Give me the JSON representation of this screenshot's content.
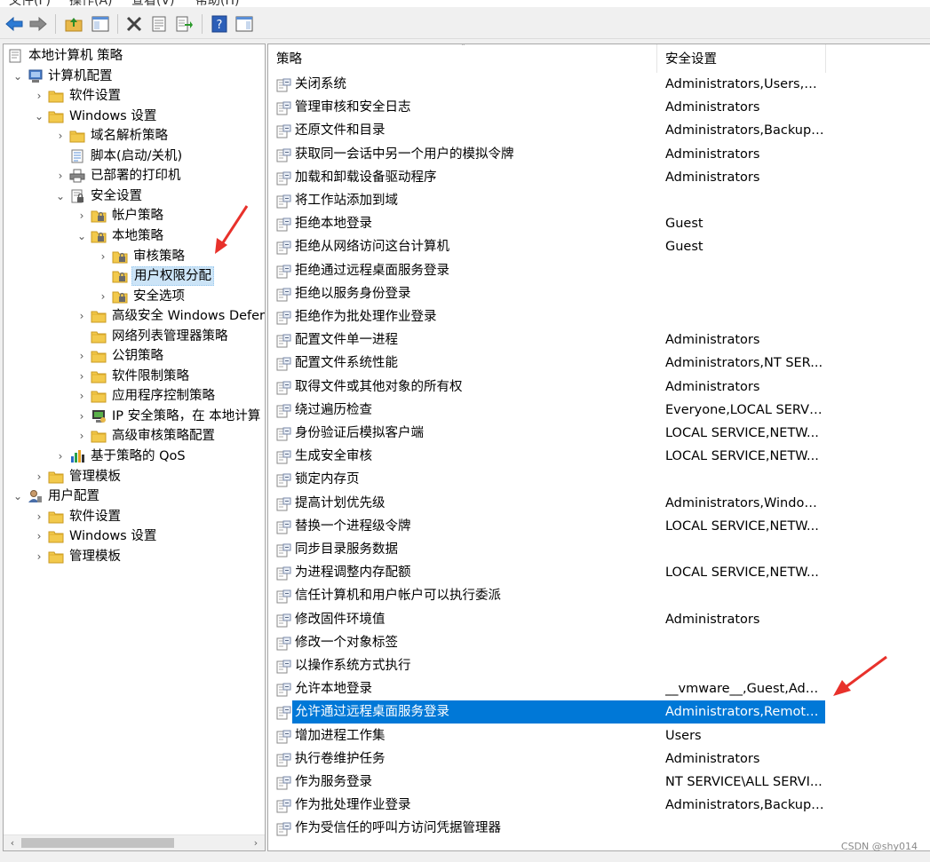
{
  "menu": [
    "文件(F)",
    "操作(A)",
    "查看(V)",
    "帮助(H)"
  ],
  "toolbar_icons": [
    "back-arrow-icon",
    "forward-arrow-icon",
    "up-folder-icon",
    "show-hide-tree-icon",
    "delete-icon",
    "properties-icon",
    "export-list-icon",
    "help-icon",
    "action-pane-icon"
  ],
  "tree": [
    {
      "label": "本地计算机 策略",
      "depth": 0,
      "arrow": "",
      "icon": "policy-doc-icon"
    },
    {
      "label": "计算机配置",
      "depth": 1,
      "arrow": "v",
      "icon": "computer-icon"
    },
    {
      "label": "软件设置",
      "depth": 2,
      "arrow": ">",
      "icon": "folder-icon"
    },
    {
      "label": "Windows 设置",
      "depth": 2,
      "arrow": "v",
      "icon": "folder-icon"
    },
    {
      "label": "域名解析策略",
      "depth": 3,
      "arrow": ">",
      "icon": "folder-icon"
    },
    {
      "label": "脚本(启动/关机)",
      "depth": 3,
      "arrow": "",
      "icon": "script-icon"
    },
    {
      "label": "已部署的打印机",
      "depth": 3,
      "arrow": ">",
      "icon": "printer-icon"
    },
    {
      "label": "安全设置",
      "depth": 3,
      "arrow": "v",
      "icon": "security-settings-icon"
    },
    {
      "label": "帐户策略",
      "depth": 4,
      "arrow": ">",
      "icon": "locked-folder-icon"
    },
    {
      "label": "本地策略",
      "depth": 4,
      "arrow": "v",
      "icon": "locked-folder-icon"
    },
    {
      "label": "审核策略",
      "depth": 5,
      "arrow": ">",
      "icon": "locked-folder-icon"
    },
    {
      "label": "用户权限分配",
      "depth": 5,
      "arrow": "",
      "icon": "locked-folder-icon",
      "selected": true
    },
    {
      "label": "安全选项",
      "depth": 5,
      "arrow": ">",
      "icon": "locked-folder-icon"
    },
    {
      "label": "高级安全 Windows Defer",
      "depth": 4,
      "arrow": ">",
      "icon": "folder-icon"
    },
    {
      "label": "网络列表管理器策略",
      "depth": 4,
      "arrow": "",
      "icon": "folder-icon"
    },
    {
      "label": "公钥策略",
      "depth": 4,
      "arrow": ">",
      "icon": "folder-icon"
    },
    {
      "label": "软件限制策略",
      "depth": 4,
      "arrow": ">",
      "icon": "folder-icon"
    },
    {
      "label": "应用程序控制策略",
      "depth": 4,
      "arrow": ">",
      "icon": "folder-icon"
    },
    {
      "label": "IP 安全策略，在 本地计算",
      "depth": 4,
      "arrow": ">",
      "icon": "ip-security-icon"
    },
    {
      "label": "高级审核策略配置",
      "depth": 4,
      "arrow": ">",
      "icon": "folder-icon"
    },
    {
      "label": "基于策略的 QoS",
      "depth": 3,
      "arrow": ">",
      "icon": "qos-chart-icon"
    },
    {
      "label": "管理模板",
      "depth": 2,
      "arrow": ">",
      "icon": "folder-icon"
    },
    {
      "label": "用户配置",
      "depth": 1,
      "arrow": "v",
      "icon": "user-icon"
    },
    {
      "label": "软件设置",
      "depth": 2,
      "arrow": ">",
      "icon": "folder-icon"
    },
    {
      "label": "Windows 设置",
      "depth": 2,
      "arrow": ">",
      "icon": "folder-icon"
    },
    {
      "label": "管理模板",
      "depth": 2,
      "arrow": ">",
      "icon": "folder-icon"
    }
  ],
  "columns": {
    "policy": "策略",
    "setting": "安全设置"
  },
  "rows": [
    {
      "policy": "关闭系统",
      "setting": "Administrators,Users,Ba..."
    },
    {
      "policy": "管理审核和安全日志",
      "setting": "Administrators"
    },
    {
      "policy": "还原文件和目录",
      "setting": "Administrators,Backup ..."
    },
    {
      "policy": "获取同一会话中另一个用户的模拟令牌",
      "setting": "Administrators"
    },
    {
      "policy": "加载和卸载设备驱动程序",
      "setting": "Administrators"
    },
    {
      "policy": "将工作站添加到域",
      "setting": ""
    },
    {
      "policy": "拒绝本地登录",
      "setting": "Guest"
    },
    {
      "policy": "拒绝从网络访问这台计算机",
      "setting": "Guest"
    },
    {
      "policy": "拒绝通过远程桌面服务登录",
      "setting": ""
    },
    {
      "policy": "拒绝以服务身份登录",
      "setting": ""
    },
    {
      "policy": "拒绝作为批处理作业登录",
      "setting": ""
    },
    {
      "policy": "配置文件单一进程",
      "setting": "Administrators"
    },
    {
      "policy": "配置文件系统性能",
      "setting": "Administrators,NT SER..."
    },
    {
      "policy": "取得文件或其他对象的所有权",
      "setting": "Administrators"
    },
    {
      "policy": "绕过遍历检查",
      "setting": "Everyone,LOCAL SERVI..."
    },
    {
      "policy": "身份验证后模拟客户端",
      "setting": "LOCAL SERVICE,NETW..."
    },
    {
      "policy": "生成安全审核",
      "setting": "LOCAL SERVICE,NETW..."
    },
    {
      "policy": "锁定内存页",
      "setting": ""
    },
    {
      "policy": "提高计划优先级",
      "setting": "Administrators,Window ..."
    },
    {
      "policy": "替换一个进程级令牌",
      "setting": "LOCAL SERVICE,NETW..."
    },
    {
      "policy": "同步目录服务数据",
      "setting": ""
    },
    {
      "policy": "为进程调整内存配额",
      "setting": "LOCAL SERVICE,NETW..."
    },
    {
      "policy": "信任计算机和用户帐户可以执行委派",
      "setting": ""
    },
    {
      "policy": "修改固件环境值",
      "setting": "Administrators"
    },
    {
      "policy": "修改一个对象标签",
      "setting": ""
    },
    {
      "policy": "以操作系统方式执行",
      "setting": ""
    },
    {
      "policy": "允许本地登录",
      "setting": "__vmware__,Guest,Adm..."
    },
    {
      "policy": "允许通过远程桌面服务登录",
      "setting": "Administrators,Remote ...",
      "selected": true
    },
    {
      "policy": "增加进程工作集",
      "setting": "Users"
    },
    {
      "policy": "执行卷维护任务",
      "setting": "Administrators"
    },
    {
      "policy": "作为服务登录",
      "setting": "NT SERVICE\\ALL SERVI..."
    },
    {
      "policy": "作为批处理作业登录",
      "setting": "Administrators,Backup ..."
    },
    {
      "policy": "作为受信任的呼叫方访问凭据管理器",
      "setting": ""
    }
  ],
  "watermark": "CSDN @shy014",
  "colors": {
    "selection": "#0078d7",
    "tree_selection": "#cce4f7",
    "annotation_arrow": "#e8312b"
  }
}
